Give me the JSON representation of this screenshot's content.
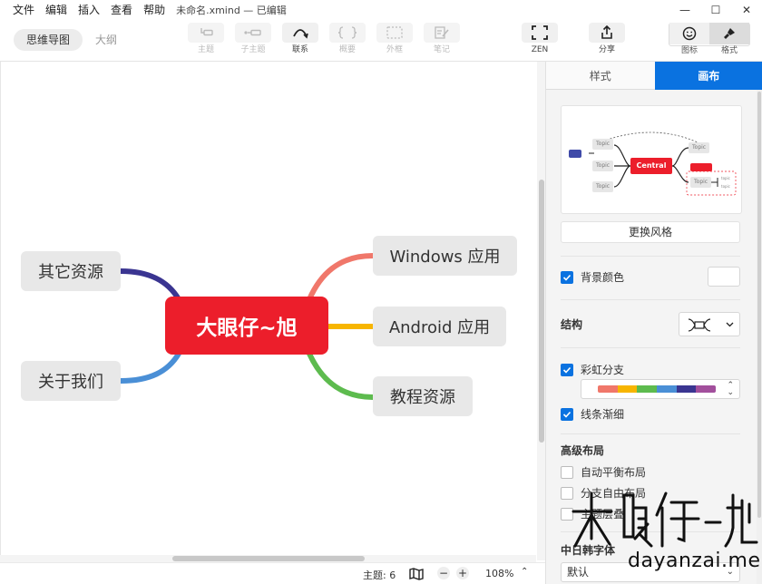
{
  "menu": {
    "items": [
      "文件",
      "编辑",
      "插入",
      "查看",
      "帮助"
    ],
    "doc_title": "未命名.xmind — 已编辑"
  },
  "window_controls": {
    "minimize": "—",
    "maximize": "☐",
    "close": "✕"
  },
  "view_tabs": [
    {
      "label": "思维导图",
      "active": true
    },
    {
      "label": "大纲",
      "active": false
    }
  ],
  "toolbar": {
    "topic": "主题",
    "subtopic": "子主题",
    "relationship": "联系",
    "summary": "概要",
    "boundary": "外框",
    "note": "笔记",
    "zen": "ZEN",
    "share": "分享",
    "icon_panel": "图标",
    "format_panel": "格式"
  },
  "mindmap": {
    "central": "大眼仔~旭",
    "right_topics": [
      "Windows 应用",
      "Android 应用",
      "教程资源"
    ],
    "left_topics": [
      "其它资源",
      "关于我们"
    ],
    "branch_colors": {
      "windows": "#f0776a",
      "android": "#f7b500",
      "tutorial": "#5dbb4e",
      "other": "#3a3591",
      "about": "#4a8fd6"
    }
  },
  "status": {
    "topics": "主题: 6",
    "zoom_minus": "−",
    "zoom_plus": "+",
    "zoom": "108%"
  },
  "panel": {
    "tabs": [
      {
        "label": "样式",
        "active": false
      },
      {
        "label": "画布",
        "active": true
      }
    ],
    "preview": {
      "central": "Central",
      "topic": "Topic",
      "small_topic": "topic"
    },
    "change_style": "更换风格",
    "background_color": {
      "label": "背景颜色",
      "checked": true,
      "color": "#ffffff"
    },
    "structure_label": "结构",
    "rainbow_branch": {
      "label": "彩虹分支",
      "checked": true,
      "colors": [
        "#f0776a",
        "#f7b500",
        "#5dbb4e",
        "#4a8fd6",
        "#3a3591",
        "#a24f9c"
      ]
    },
    "tapered_lines": {
      "label": "线条渐细",
      "checked": true
    },
    "advanced_layout": "高级布局",
    "auto_balance": {
      "label": "自动平衡布局",
      "checked": false
    },
    "free_position": {
      "label": "分支自由布局",
      "checked": false
    },
    "overlap": {
      "label": "主题层叠",
      "checked": false
    },
    "cjk_font_label": "中日韩字体",
    "cjk_font_value": "默认"
  },
  "watermark": {
    "url": "dayanzai.me",
    "logo_text": "大眼仔-旭"
  }
}
